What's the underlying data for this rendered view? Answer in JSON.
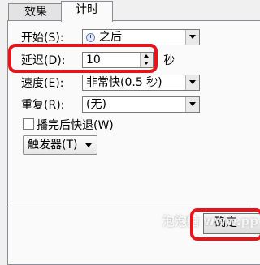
{
  "tabs": [
    {
      "label": "效果"
    },
    {
      "label": "计时"
    }
  ],
  "start": {
    "label": "开始(S):",
    "value": "之后"
  },
  "delay": {
    "label": "延迟(D):",
    "value": "10",
    "unit": "秒"
  },
  "speed": {
    "label": "速度(E):",
    "value": "非常快(0.5 秒)"
  },
  "repeat": {
    "label": "重复(R):",
    "value": "(无)"
  },
  "rewind": {
    "label": "播完后快退(W)",
    "checked": false
  },
  "trigger": {
    "label": "触发器(T)"
  },
  "ok_button": {
    "label": "确定"
  },
  "watermark": "泡泡糖 www.pp"
}
